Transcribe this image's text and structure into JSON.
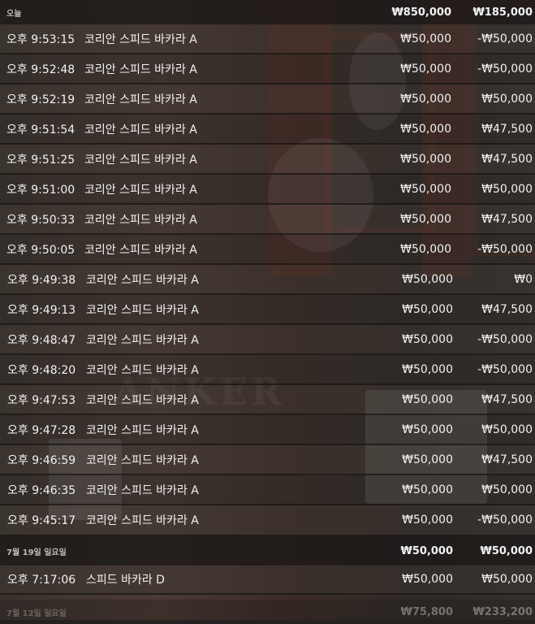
{
  "groups": [
    {
      "date": "오늘",
      "total_bet": "₩850,000",
      "total_pl": "₩185,000",
      "rows": [
        {
          "time": "오후 9:53:15",
          "game": "코리안 스피드 바카라 A",
          "bet": "₩50,000",
          "pl": "-₩50,000"
        },
        {
          "time": "오후 9:52:48",
          "game": "코리안 스피드 바카라 A",
          "bet": "₩50,000",
          "pl": "-₩50,000"
        },
        {
          "time": "오후 9:52:19",
          "game": "코리안 스피드 바카라 A",
          "bet": "₩50,000",
          "pl": "₩50,000"
        },
        {
          "time": "오후 9:51:54",
          "game": "코리안 스피드 바카라 A",
          "bet": "₩50,000",
          "pl": "₩47,500"
        },
        {
          "time": "오후 9:51:25",
          "game": "코리안 스피드 바카라 A",
          "bet": "₩50,000",
          "pl": "₩47,500"
        },
        {
          "time": "오후 9:51:00",
          "game": "코리안 스피드 바카라 A",
          "bet": "₩50,000",
          "pl": "₩50,000"
        },
        {
          "time": "오후 9:50:33",
          "game": "코리안 스피드 바카라 A",
          "bet": "₩50,000",
          "pl": "₩47,500"
        },
        {
          "time": "오후 9:50:05",
          "game": "코리안 스피드 바카라 A",
          "bet": "₩50,000",
          "pl": "-₩50,000"
        },
        {
          "time": "오후 9:49:38",
          "game": "코리안 스피드 바카라 A",
          "bet": "₩50,000",
          "pl": "₩0"
        },
        {
          "time": "오후 9:49:13",
          "game": "코리안 스피드 바카라 A",
          "bet": "₩50,000",
          "pl": "₩47,500"
        },
        {
          "time": "오후 9:48:47",
          "game": "코리안 스피드 바카라 A",
          "bet": "₩50,000",
          "pl": "-₩50,000"
        },
        {
          "time": "오후 9:48:20",
          "game": "코리안 스피드 바카라 A",
          "bet": "₩50,000",
          "pl": "-₩50,000"
        },
        {
          "time": "오후 9:47:53",
          "game": "코리안 스피드 바카라 A",
          "bet": "₩50,000",
          "pl": "₩47,500"
        },
        {
          "time": "오후 9:47:28",
          "game": "코리안 스피드 바카라 A",
          "bet": "₩50,000",
          "pl": "₩50,000"
        },
        {
          "time": "오후 9:46:59",
          "game": "코리안 스피드 바카라 A",
          "bet": "₩50,000",
          "pl": "₩47,500"
        },
        {
          "time": "오후 9:46:35",
          "game": "코리안 스피드 바카라 A",
          "bet": "₩50,000",
          "pl": "₩50,000"
        },
        {
          "time": "오후 9:45:17",
          "game": "코리안 스피드 바카라 A",
          "bet": "₩50,000",
          "pl": "-₩50,000"
        }
      ]
    },
    {
      "date": "7월 19일 일요일",
      "total_bet": "₩50,000",
      "total_pl": "₩50,000",
      "rows": [
        {
          "time": "오후 7:17:06",
          "game": "스피드 바카라 D",
          "bet": "₩50,000",
          "pl": "₩50,000"
        }
      ]
    },
    {
      "date": "7월 12일 일요일",
      "total_bet": "₩75,800",
      "total_pl": "₩233,200",
      "rows": []
    }
  ]
}
